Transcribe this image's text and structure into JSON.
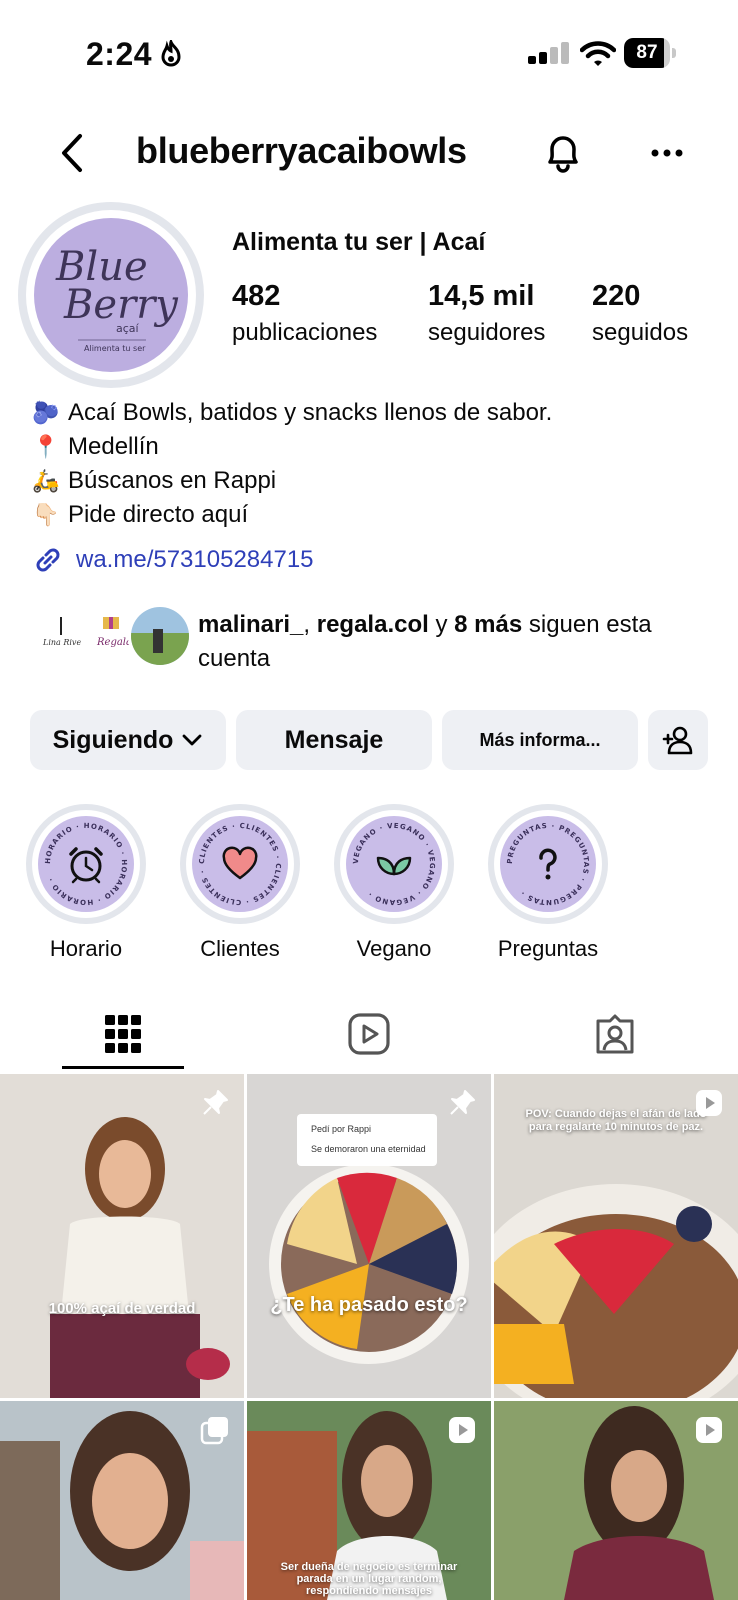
{
  "status_bar": {
    "time": "2:24",
    "battery": "87",
    "battery_level": 0.87
  },
  "header": {
    "handle": "blueberryacaibowls"
  },
  "profile": {
    "avatar_text": {
      "line1": "Blue",
      "line2": "Berry",
      "line3": "açaí",
      "line4": "Alimenta tu ser"
    },
    "display_name": "Alimenta tu ser | Acaí",
    "stats": [
      {
        "number": "482",
        "label": "publicaciones"
      },
      {
        "number": "14,5 mil",
        "label": "seguidores"
      },
      {
        "number": "220",
        "label": "seguidos"
      }
    ],
    "bio": [
      {
        "emoji": "🫐",
        "text": "Acaí Bowls, batidos y snacks llenos de sabor."
      },
      {
        "emoji": "📍",
        "text": "Medellín"
      },
      {
        "emoji": "🛵",
        "text": "Búscanos en Rappi"
      },
      {
        "emoji": "👇🏻",
        "text": "Pide directo aquí"
      }
    ],
    "link": "wa.me/573105284715"
  },
  "mutual": {
    "avatar_labels": [
      "Lina Rivera",
      "Regala"
    ],
    "user1": "malinari_",
    "comma": ",",
    "user2": "regala.col",
    "y": "y",
    "more": "8 más",
    "suffix": "siguen esta cuenta"
  },
  "buttons": {
    "following": "Siguiendo",
    "message": "Mensaje",
    "more_info": "Más informa..."
  },
  "highlights": [
    {
      "label": "Horario",
      "ring_text": "HORARIO · HORARIO · HORARIO · HORARIO ·",
      "icon": "alarm-clock-icon"
    },
    {
      "label": "Clientes",
      "ring_text": "CLIENTES · CLIENTES · CLIENTES · CLIENTES ·",
      "icon": "heart-icon"
    },
    {
      "label": "Vegano",
      "ring_text": "VEGANO · VEGANO · VEGANO · VEGANO ·",
      "icon": "leaf-icon"
    },
    {
      "label": "Preguntas",
      "ring_text": "PREGUNTAS · PREGUNTAS · PREGUNTAS ·",
      "icon": "question-mark-icon"
    }
  ],
  "tabs": [
    "grid-icon",
    "reels-icon",
    "tagged-icon"
  ],
  "posts": [
    {
      "caption": "100% açaí de verdad",
      "badge": "pin-icon"
    },
    {
      "caption": "¿Te ha pasado esto?",
      "badge": "pin-icon",
      "chat1": "Pedí por Rappi",
      "chat2": "Se demoraron una eternidad"
    },
    {
      "caption": "POV: Cuando dejas el afán de lado para regalarte 10 minutos de paz.",
      "badge": "reel-icon"
    },
    {
      "caption": "",
      "badge": "carousel-icon"
    },
    {
      "caption": "Ser dueña de negocio es terminar parada en un lugar random, respondiendo mensajes",
      "badge": "reel-icon"
    },
    {
      "caption": "",
      "badge": "reel-icon"
    }
  ],
  "colors": {
    "accent_link": "#2e3fb8",
    "avatar_bg": "#bcaee0",
    "highlight_bg": "#c9bde8",
    "button_bg": "#eef0f4"
  }
}
